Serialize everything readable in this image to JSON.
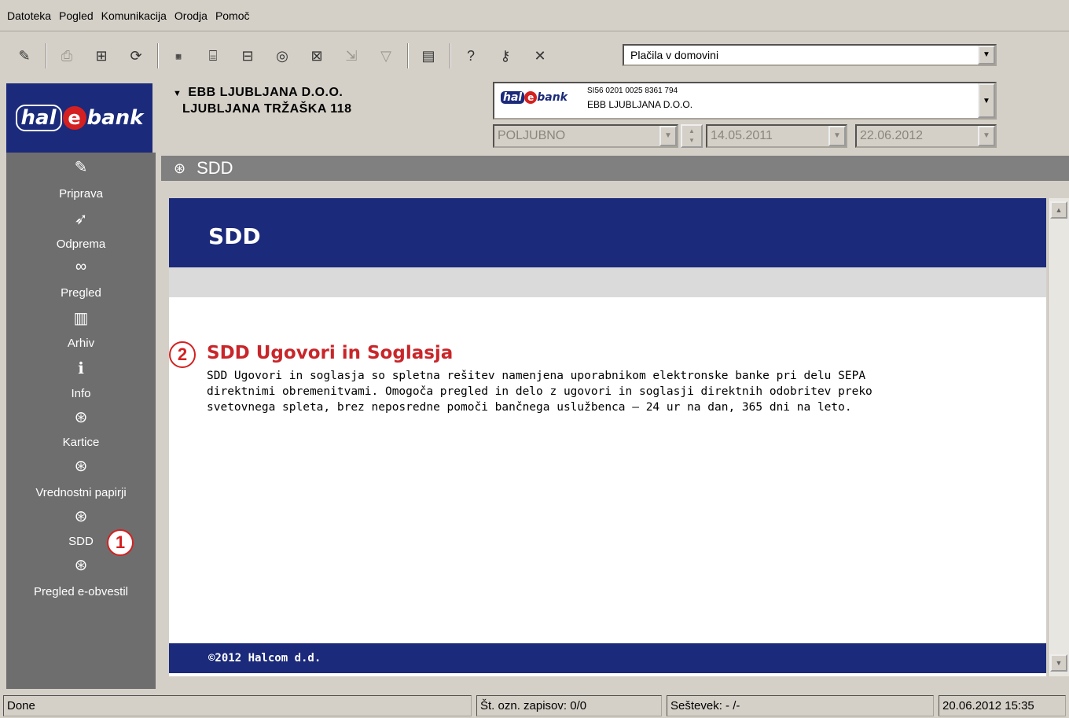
{
  "menu": [
    "Datoteka",
    "Pogled",
    "Komunikacija",
    "Orodja",
    "Pomoč"
  ],
  "toolbar": {
    "selected_view": "Plačila v domovini",
    "icons": [
      "wand-icon",
      "print-icon",
      "book-icon",
      "refresh-icon",
      "binary-icon",
      "printer-list-icon",
      "import-icon",
      "cd-icon",
      "stamp-icon",
      "export-icon",
      "filter-icon",
      "calculator-icon",
      "help-icon",
      "key-icon",
      "tools-icon"
    ]
  },
  "logo": {
    "hal": "hal",
    "e": "e",
    "bank": "bank"
  },
  "company": {
    "line1": "EBB LJUBLJANA D.O.O.",
    "line2": "LJUBLJANA TRŽAŠKA 118"
  },
  "account": {
    "iban": "SI56 0201 0025 8361 794",
    "name": "EBB LJUBLJANA D.O.O."
  },
  "filters": {
    "type": "POLJUBNO",
    "date_from": "14.05.2011",
    "date_to": "22.06.2012"
  },
  "sidebar": {
    "items": [
      {
        "label": "Priprava",
        "icon": "edit-icon"
      },
      {
        "label": "Odprema",
        "icon": "send-icon"
      },
      {
        "label": "Pregled",
        "icon": "binoculars-icon"
      },
      {
        "label": "Arhiv",
        "icon": "archive-icon"
      },
      {
        "label": "Info",
        "icon": "info-icon"
      },
      {
        "label": "Kartice",
        "icon": "globe-icon"
      },
      {
        "label": "Vrednostni papirji",
        "icon": "globe-icon"
      },
      {
        "label": "SDD",
        "icon": "globe-icon"
      },
      {
        "label": "Pregled e-obvestil",
        "icon": "globe-icon"
      }
    ]
  },
  "callouts": {
    "one": "1",
    "two": "2"
  },
  "page": {
    "title": "SDD"
  },
  "content": {
    "banner": "SDD",
    "heading": "SDD Ugovori in Soglasja",
    "description_lines": [
      "SDD Ugovori in soglasja so spletna rešitev namenjena uporabnikom elektronske banke pri delu SEPA",
      "direktnimi obremenitvami. Omogoča pregled in delo z ugovori in soglasji direktnih odobritev preko",
      "svetovnega spleta, brez neposredne pomoči bančnega uslužbenca – 24 ur na dan, 365 dni na leto."
    ],
    "footer": "©2012 Halcom d.d."
  },
  "status": {
    "left": "Done",
    "records": "Št. ozn. zapisov: 0/0",
    "sum": "Seštevek: - /-",
    "datetime": "20.06.2012 15:35"
  },
  "colors": {
    "brand_navy": "#1b2a7a",
    "accent_red": "#c8262a",
    "sidebar_grey": "#6e6e6e"
  }
}
